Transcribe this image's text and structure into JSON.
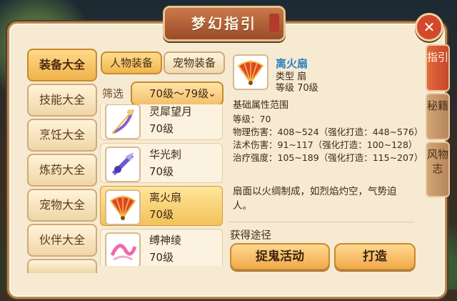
{
  "window": {
    "title": "梦幻指引"
  },
  "categories": [
    {
      "label": "装备大全",
      "active": true
    },
    {
      "label": "技能大全",
      "active": false
    },
    {
      "label": "烹饪大全",
      "active": false
    },
    {
      "label": "炼药大全",
      "active": false
    },
    {
      "label": "宠物大全",
      "active": false
    },
    {
      "label": "伙伴大全",
      "active": false
    }
  ],
  "sub_tabs": [
    {
      "label": "人物装备",
      "active": true
    },
    {
      "label": "宠物装备",
      "active": false
    }
  ],
  "filter": {
    "label": "筛选",
    "selected": "70级～79级"
  },
  "items": [
    {
      "name": "灵犀望月",
      "level": "70级",
      "icon": "bow-icon",
      "active": false
    },
    {
      "name": "华光刺",
      "level": "70级",
      "icon": "claw-icon",
      "active": false
    },
    {
      "name": "离火扇",
      "level": "70级",
      "icon": "fan-icon",
      "active": true
    },
    {
      "name": "缚神绫",
      "level": "70级",
      "icon": "ribbon-icon",
      "active": false
    }
  ],
  "detail": {
    "name": "离火扇",
    "type": "类型  扇",
    "level": "等级  70级",
    "section": "基础属性范围",
    "stats": [
      "等级：70",
      "物理伤害：408~524（强化打造：448~576）",
      "法术伤害：91~117（强化打造：100~128）",
      "治疗强度：105~189（强化打造：115~207）"
    ],
    "description": "扇面以火绸制成，如烈焰灼空，气势迫人。"
  },
  "obtain": {
    "label": "获得途径",
    "buttons": [
      "捉鬼活动",
      "打造"
    ]
  },
  "side_tabs": [
    {
      "label": "指引",
      "active": true
    },
    {
      "label": "秘籍",
      "active": false
    },
    {
      "label": "风物志",
      "active": false
    }
  ],
  "colors": {
    "accent": "#f1b64c",
    "panel": "#f6ead2",
    "close": "#d2492d",
    "item_name": "#2a7fc0"
  }
}
